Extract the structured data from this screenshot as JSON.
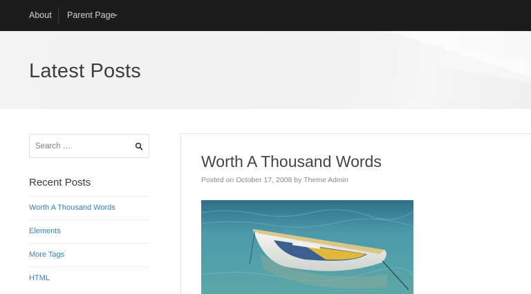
{
  "nav": {
    "about": "About",
    "parent_page": "Parent Page"
  },
  "hero": {
    "title": "Latest Posts"
  },
  "sidebar": {
    "search_placeholder": "Search …",
    "recent_title": "Recent Posts",
    "recent_posts": [
      "Worth A Thousand Words",
      "Elements",
      "More Tags",
      "HTML"
    ]
  },
  "post": {
    "title": "Worth A Thousand Words",
    "meta_prefix": "Posted on",
    "date": "October 17, 2008",
    "by": "by",
    "author": "Theme Admin"
  },
  "colors": {
    "nav_bg": "#1c1c1c",
    "link": "#3a7fbf",
    "water": "#3f8f9f"
  }
}
